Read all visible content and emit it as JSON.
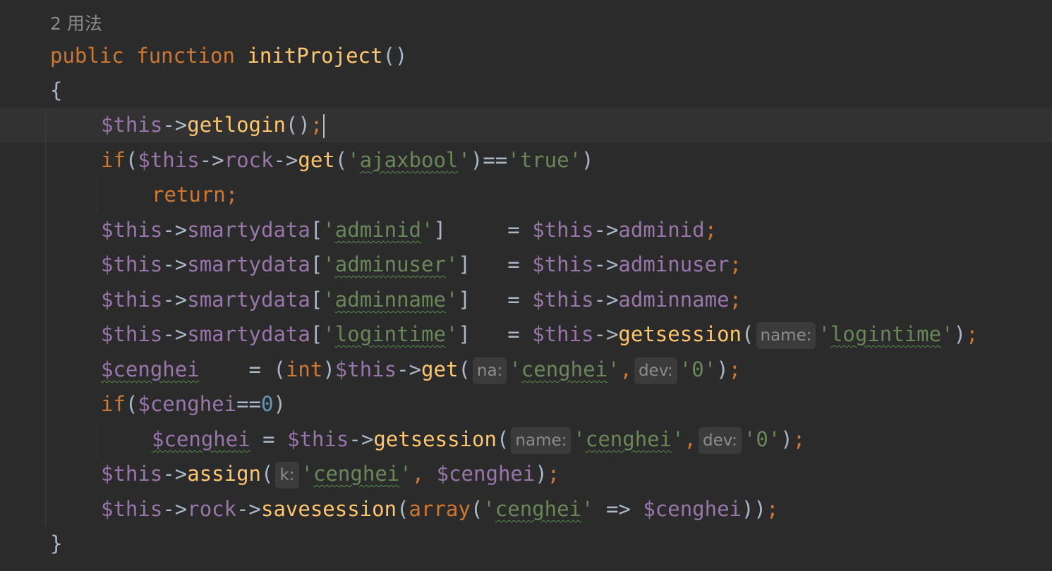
{
  "usages_hint": "2 用法",
  "lines": {
    "l1": {
      "public": "public",
      "function": "function",
      "name": "initProject",
      "parens": "()"
    },
    "l2": {
      "brace": "{"
    },
    "l3": {
      "var": "$this",
      "arrow": "->",
      "method": "getlogin",
      "parens": "()",
      "semi": ";"
    },
    "l4": {
      "if": "if",
      "open": "(",
      "var": "$this",
      "arrow1": "->",
      "prop": "rock",
      "arrow2": "->",
      "method": "get",
      "popen": "(",
      "q1": "'",
      "str1": "ajaxbool",
      "q2": "'",
      "pclose": ")",
      "eq": "==",
      "str2": "'true'",
      "close": ")"
    },
    "l5": {
      "return": "return",
      "semi": ";"
    },
    "l6": {
      "var": "$this",
      "arrow": "->",
      "prop": "smartydata",
      "bopen": "[",
      "q1": "'",
      "key": "adminid",
      "q2": "'",
      "bclose": "]",
      "pad": "    ",
      "eq": "=",
      "var2": "$this",
      "arrow2": "->",
      "prop2": "adminid",
      "semi": ";"
    },
    "l7": {
      "var": "$this",
      "arrow": "->",
      "prop": "smartydata",
      "bopen": "[",
      "q1": "'",
      "key": "adminuser",
      "q2": "'",
      "bclose": "]",
      "pad": "  ",
      "eq": "=",
      "var2": "$this",
      "arrow2": "->",
      "prop2": "adminuser",
      "semi": ";"
    },
    "l8": {
      "var": "$this",
      "arrow": "->",
      "prop": "smartydata",
      "bopen": "[",
      "q1": "'",
      "key": "adminname",
      "q2": "'",
      "bclose": "]",
      "pad": "  ",
      "eq": "=",
      "var2": "$this",
      "arrow2": "->",
      "prop2": "adminname",
      "semi": ";"
    },
    "l9": {
      "var": "$this",
      "arrow": "->",
      "prop": "smartydata",
      "bopen": "[",
      "q1": "'",
      "key": "logintime",
      "q2": "'",
      "bclose": "]",
      "pad": "  ",
      "eq": "=",
      "var2": "$this",
      "arrow2": "->",
      "method": "getsession",
      "popen": "(",
      "hint_name": "name:",
      "sq1": "'",
      "arg": "logintime",
      "sq2": "'",
      "pclose": ")",
      "semi": ";"
    },
    "l10": {
      "var": "$cenghei",
      "pad": "    ",
      "eq": "=",
      "cast_open": "(",
      "cast": "int",
      "cast_close": ")",
      "var2": "$this",
      "arrow": "->",
      "method": "get",
      "popen": "(",
      "hint_na": "na:",
      "sq1": "'",
      "arg1": "cenghei",
      "sq2": "'",
      "comma": ",",
      "hint_dev": "dev:",
      "arg2": "'0'",
      "pclose": ")",
      "semi": ";"
    },
    "l11": {
      "if": "if",
      "open": "(",
      "var": "$cenghei",
      "eq": "==",
      "num": "0",
      "close": ")"
    },
    "l12": {
      "var": "$cenghei",
      "eq": "=",
      "var2": "$this",
      "arrow": "->",
      "method": "getsession",
      "popen": "(",
      "hint_name": "name:",
      "sq1": "'",
      "arg1": "cenghei",
      "sq2": "'",
      "comma": ",",
      "hint_dev": "dev:",
      "arg2": "'0'",
      "pclose": ")",
      "semi": ";"
    },
    "l13": {
      "var": "$this",
      "arrow": "->",
      "method": "assign",
      "popen": "(",
      "hint_k": "k:",
      "sq1": "'",
      "arg1": "cenghei",
      "sq2": "'",
      "comma": ",",
      "var2": "$cenghei",
      "pclose": ")",
      "semi": ";"
    },
    "l14": {
      "var": "$this",
      "arrow1": "->",
      "prop": "rock",
      "arrow2": "->",
      "method": "savesession",
      "popen": "(",
      "array": "array",
      "aopen": "(",
      "sq1": "'",
      "key": "cenghei",
      "sq2": "'",
      "darrow": "=>",
      "var2": "$cenghei",
      "aclose": "))",
      "semi": ";"
    },
    "l15": {
      "brace": "}"
    }
  }
}
